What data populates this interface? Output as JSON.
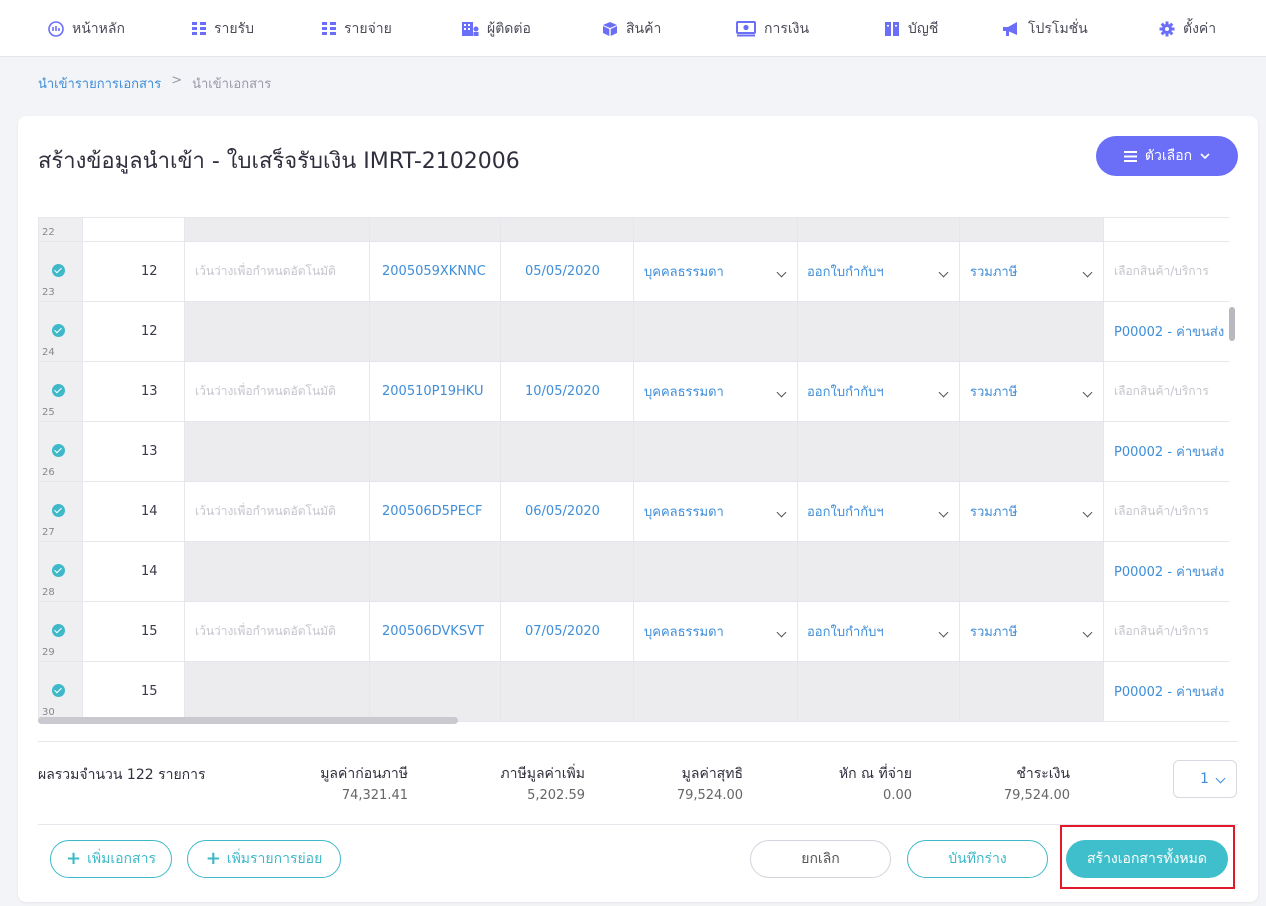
{
  "nav": [
    {
      "label": "หน้าหลัก",
      "icon": "home-icon"
    },
    {
      "label": "รายรับ",
      "icon": "income-icon"
    },
    {
      "label": "รายจ่าย",
      "icon": "expense-icon"
    },
    {
      "label": "ผู้ติดต่อ",
      "icon": "contacts-icon"
    },
    {
      "label": "สินค้า",
      "icon": "product-box-icon"
    },
    {
      "label": "การเงิน",
      "icon": "money-icon"
    },
    {
      "label": "บัญชี",
      "icon": "book-icon"
    },
    {
      "label": "โปรโมชั่น",
      "icon": "megaphone-icon"
    },
    {
      "label": "ตั้งค่า",
      "icon": "gear-icon"
    }
  ],
  "breadcrumb": {
    "link": "นำเข้ารายการเอกสาร",
    "sep": ">",
    "current": "นำเข้าเอกสาร"
  },
  "page": {
    "title": "สร้างข้อมูลนำเข้า - ใบเสร็จรับเงิน IMRT-2102006",
    "options_label": "ตัวเลือก"
  },
  "grid": {
    "first_row_num": "22",
    "rows": [
      {
        "rn": "23",
        "no": "12",
        "auto": "เว้นว่างเพื่อกำหนดอัตโนมัติ",
        "code": "2005059XKNNC",
        "date": "05/05/2020",
        "type": "บุคคลธรรมดา",
        "doc": "ออกใบกำกับฯ",
        "tax": "รวมภาษี",
        "product": "เลือกสินค้า/บริการ",
        "product_placeholder": true
      },
      {
        "rn": "24",
        "no": "12",
        "product": "P00002 - ค่าขนส่ง",
        "sub": true
      },
      {
        "rn": "25",
        "no": "13",
        "auto": "เว้นว่างเพื่อกำหนดอัตโนมัติ",
        "code": "200510P19HKU",
        "date": "10/05/2020",
        "type": "บุคคลธรรมดา",
        "doc": "ออกใบกำกับฯ",
        "tax": "รวมภาษี",
        "product": "เลือกสินค้า/บริการ",
        "product_placeholder": true
      },
      {
        "rn": "26",
        "no": "13",
        "product": "P00002 - ค่าขนส่ง",
        "sub": true
      },
      {
        "rn": "27",
        "no": "14",
        "auto": "เว้นว่างเพื่อกำหนดอัตโนมัติ",
        "code": "200506D5PECF",
        "date": "06/05/2020",
        "type": "บุคคลธรรมดา",
        "doc": "ออกใบกำกับฯ",
        "tax": "รวมภาษี",
        "product": "เลือกสินค้า/บริการ",
        "product_placeholder": true
      },
      {
        "rn": "28",
        "no": "14",
        "product": "P00002 - ค่าขนส่ง",
        "sub": true
      },
      {
        "rn": "29",
        "no": "15",
        "auto": "เว้นว่างเพื่อกำหนดอัตโนมัติ",
        "code": "200506DVKSVT",
        "date": "07/05/2020",
        "type": "บุคคลธรรมดา",
        "doc": "ออกใบกำกับฯ",
        "tax": "รวมภาษี",
        "product": "เลือกสินค้า/บริการ",
        "product_placeholder": true
      },
      {
        "rn": "30",
        "no": "15",
        "product": "P00002 - ค่าขนส่ง",
        "sub": true
      }
    ]
  },
  "summary": {
    "count_label": "ผลรวมจำนวน 122 รายการ",
    "cols": [
      {
        "header": "มูลค่าก่อนภาษี",
        "value": "74,321.41"
      },
      {
        "header": "ภาษีมูลค่าเพิ่ม",
        "value": "5,202.59"
      },
      {
        "header": "มูลค่าสุทธิ",
        "value": "79,524.00"
      },
      {
        "header": "หัก ณ ที่จ่าย",
        "value": "0.00"
      },
      {
        "header": "ชำระเงิน",
        "value": "79,524.00"
      }
    ],
    "page": "1"
  },
  "footer": {
    "add_doc": "เพิ่มเอกสาร",
    "add_item": "เพิ่มรายการย่อย",
    "cancel": "ยกเลิก",
    "save_draft": "บันทึกร่าง",
    "create_all": "สร้างเอกสารทั้งหมด"
  },
  "colors": {
    "accent": "#6b6ef7",
    "teal": "#3fbfcb",
    "link": "#3f8ed9",
    "highlight": "#e3192b"
  }
}
